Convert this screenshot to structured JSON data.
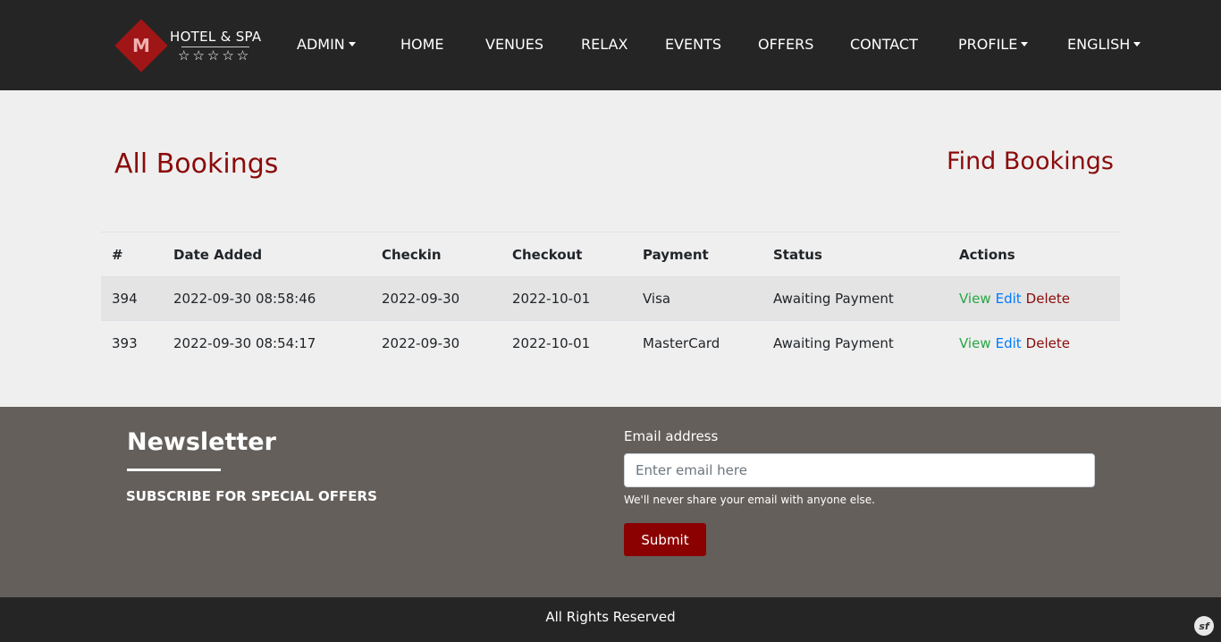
{
  "brand": {
    "logo_mark": "M",
    "name": "HOTEL & SPA",
    "stars": "☆☆☆☆☆"
  },
  "nav": {
    "admin": "ADMIN",
    "home": "HOME",
    "venues": "VENUES",
    "relax": "RELAX",
    "events": "EVENTS",
    "offers": "OFFERS",
    "contact": "CONTACT",
    "profile": "PROFILE",
    "language": "ENGLISH"
  },
  "main": {
    "title": "All Bookings",
    "find_link": "Find Bookings"
  },
  "table": {
    "columns": [
      "#",
      "Date Added",
      "Checkin",
      "Checkout",
      "Payment",
      "Status",
      "Actions"
    ],
    "rows": [
      {
        "id": "394",
        "date_added": "2022-09-30 08:58:46",
        "checkin": "2022-09-30",
        "checkout": "2022-10-01",
        "payment": "Visa",
        "status": "Awaiting Payment"
      },
      {
        "id": "393",
        "date_added": "2022-09-30 08:54:17",
        "checkin": "2022-09-30",
        "checkout": "2022-10-01",
        "payment": "MasterCard",
        "status": "Awaiting Payment"
      }
    ],
    "actions": {
      "view": "View",
      "edit": "Edit",
      "delete": "Delete"
    }
  },
  "newsletter": {
    "title": "Newsletter",
    "subtitle": "SUBSCRIBE FOR SPECIAL OFFERS",
    "email_label": "Email address",
    "email_placeholder": "Enter email here",
    "email_value": "",
    "help_text": "We'll never share your email with anyone else.",
    "submit_label": "Submit"
  },
  "footer": {
    "text": "All Rights Reserved",
    "badge": "sf"
  },
  "colors": {
    "accent": "#8b0a0a",
    "nav_bg": "#252525",
    "newsletter_bg": "#645f5b",
    "view": "#28a745",
    "edit": "#007bff"
  },
  "icons": {
    "logo": "diamond-logo-icon",
    "dropdown": "caret-down-icon",
    "framework_badge": "symfony-icon"
  }
}
